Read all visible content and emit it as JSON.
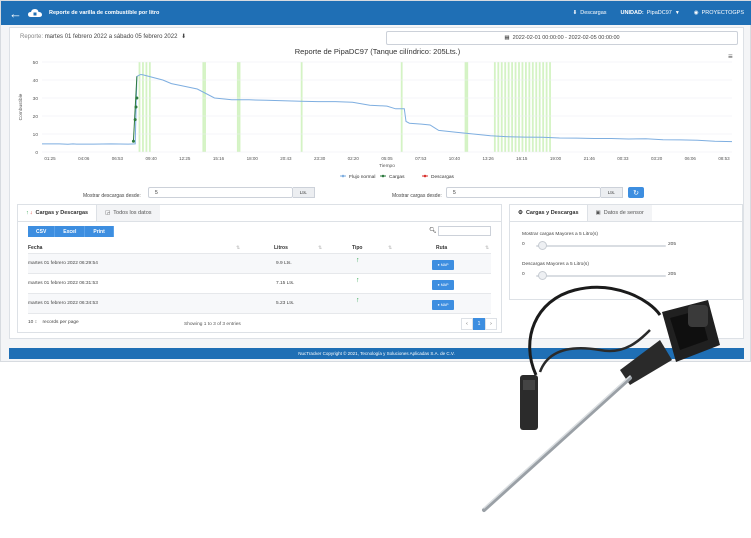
{
  "header": {
    "title": "Reporte de varilla de combustible por litro",
    "downloads_label": "Descargas",
    "unidad_label": "UNIDAD:",
    "unidad_value": "PipaDC97",
    "user_label": "PROYECTOGPS"
  },
  "report": {
    "prefix": "Reporte:",
    "range_text": "martes 01 febrero 2022 a sábado 05 febrero 2022",
    "date_range_value": "2022-02-01 00:00:00 - 2022-02-05 00:00:00"
  },
  "chart_data": {
    "type": "line",
    "title": "Reporte de PipaDC97 (Tanque cilíndrico: 205Lts.)",
    "ylabel": "Combustible",
    "xlabel": "Tiempo",
    "ylim": [
      0,
      50
    ],
    "yticks": [
      "50",
      "40",
      "30",
      "20",
      "10",
      "0"
    ],
    "x_ticks": [
      "01:25",
      "04:06",
      "06:53",
      "09:40",
      "12:25",
      "15:16",
      "18:00",
      "20:43",
      "23:30",
      "02:20",
      "05:05",
      "07:53",
      "10:40",
      "13:26",
      "16:15",
      "19:00",
      "21:46",
      "00:33",
      "03:20",
      "06:06",
      "08:53"
    ],
    "series": [
      {
        "name": "Flujo normal",
        "color": "#7eaee0",
        "x": [
          0,
          10,
          15,
          18,
          20,
          30,
          40,
          50,
          54,
          55,
          57,
          58,
          60,
          70,
          75,
          80,
          90,
          100,
          110,
          120,
          130,
          140,
          150,
          160,
          170,
          180,
          190,
          200,
          205,
          210,
          211,
          213,
          220,
          225,
          230,
          240,
          250,
          260,
          270,
          280,
          290,
          300,
          310,
          320,
          330,
          340,
          350,
          360,
          370,
          380,
          390,
          400
        ],
        "y": [
          4.5,
          4.5,
          4.3,
          4.5,
          4.4,
          4.4,
          4.5,
          4.4,
          4.5,
          42,
          43,
          43,
          42.5,
          40,
          38,
          37,
          35,
          30,
          29,
          29,
          28.7,
          28.5,
          28.2,
          28,
          28,
          27.6,
          26,
          25.5,
          24,
          24,
          17,
          16,
          15.5,
          15,
          12,
          11,
          10,
          9,
          8.5,
          8.3,
          8.2,
          7.8,
          7.7,
          7.5,
          7.5,
          7.2,
          7.4,
          6.8,
          6.7,
          6.5,
          6,
          5.8
        ]
      },
      {
        "name": "Cargas",
        "color": "#2c7a3e",
        "x": [
          53,
          54,
          54.5,
          55
        ],
        "y": [
          6,
          18,
          25,
          30
        ]
      },
      {
        "name": "Descargas",
        "color": "#d9322e",
        "x": [],
        "y": []
      }
    ],
    "highlight_bands_x": [
      56,
      58,
      60,
      62,
      93,
      94,
      113,
      114,
      150,
      208,
      245,
      246,
      262,
      264,
      266,
      268,
      270,
      272,
      274,
      276,
      278,
      280,
      282,
      284,
      286,
      288,
      290,
      292,
      294
    ],
    "x_range": [
      0,
      400
    ],
    "legend_position": "bottom"
  },
  "filters": {
    "descargas_label": "Mostrar descargas desde:",
    "descargas_value": "5",
    "cargas_label": "Mostrar cargas desde:",
    "cargas_value": "5",
    "unit": "Lts."
  },
  "table_panel": {
    "tab_active": "Cargas y Descargas",
    "tab_other": "Todos los datos",
    "export_buttons": [
      "CSV",
      "Excel",
      "Print"
    ],
    "headers": {
      "fecha": "Fecha",
      "litros": "Litros",
      "tipo": "Tipo",
      "ruta": "Ruta"
    },
    "rows": [
      {
        "fecha": "martes 01 febrero 2022 06:29:54",
        "litros": "9.9 Lts."
      },
      {
        "fecha": "martes 01 febrero 2022 06:31:53",
        "litros": "7.15 Lts."
      },
      {
        "fecha": "martes 01 febrero 2022 06:34:53",
        "litros": "5.23 Lts."
      }
    ],
    "map_label": "MAP",
    "page_size": "10",
    "records_label": "records per page",
    "showing": "Showing 1 to 3 of 3 entries",
    "current_page": "1"
  },
  "settings_panel": {
    "tab_active": "Cargas y Descargas",
    "tab_other": "Datos de sensor",
    "slider1_label": "Mostrar cargas Mayores a 5 Litro(s)",
    "slider1_min": "0",
    "slider1_max": "205",
    "slider1_value": 5,
    "slider2_label": "Descargas Mayores a 5 Litro(s)",
    "slider2_min": "0",
    "slider2_max": "205",
    "slider2_value": 5
  },
  "footer": {
    "text": "NucTracker Copyright © 2021, Tecnología y Soluciones Aplicadas S.A. de C.V."
  }
}
